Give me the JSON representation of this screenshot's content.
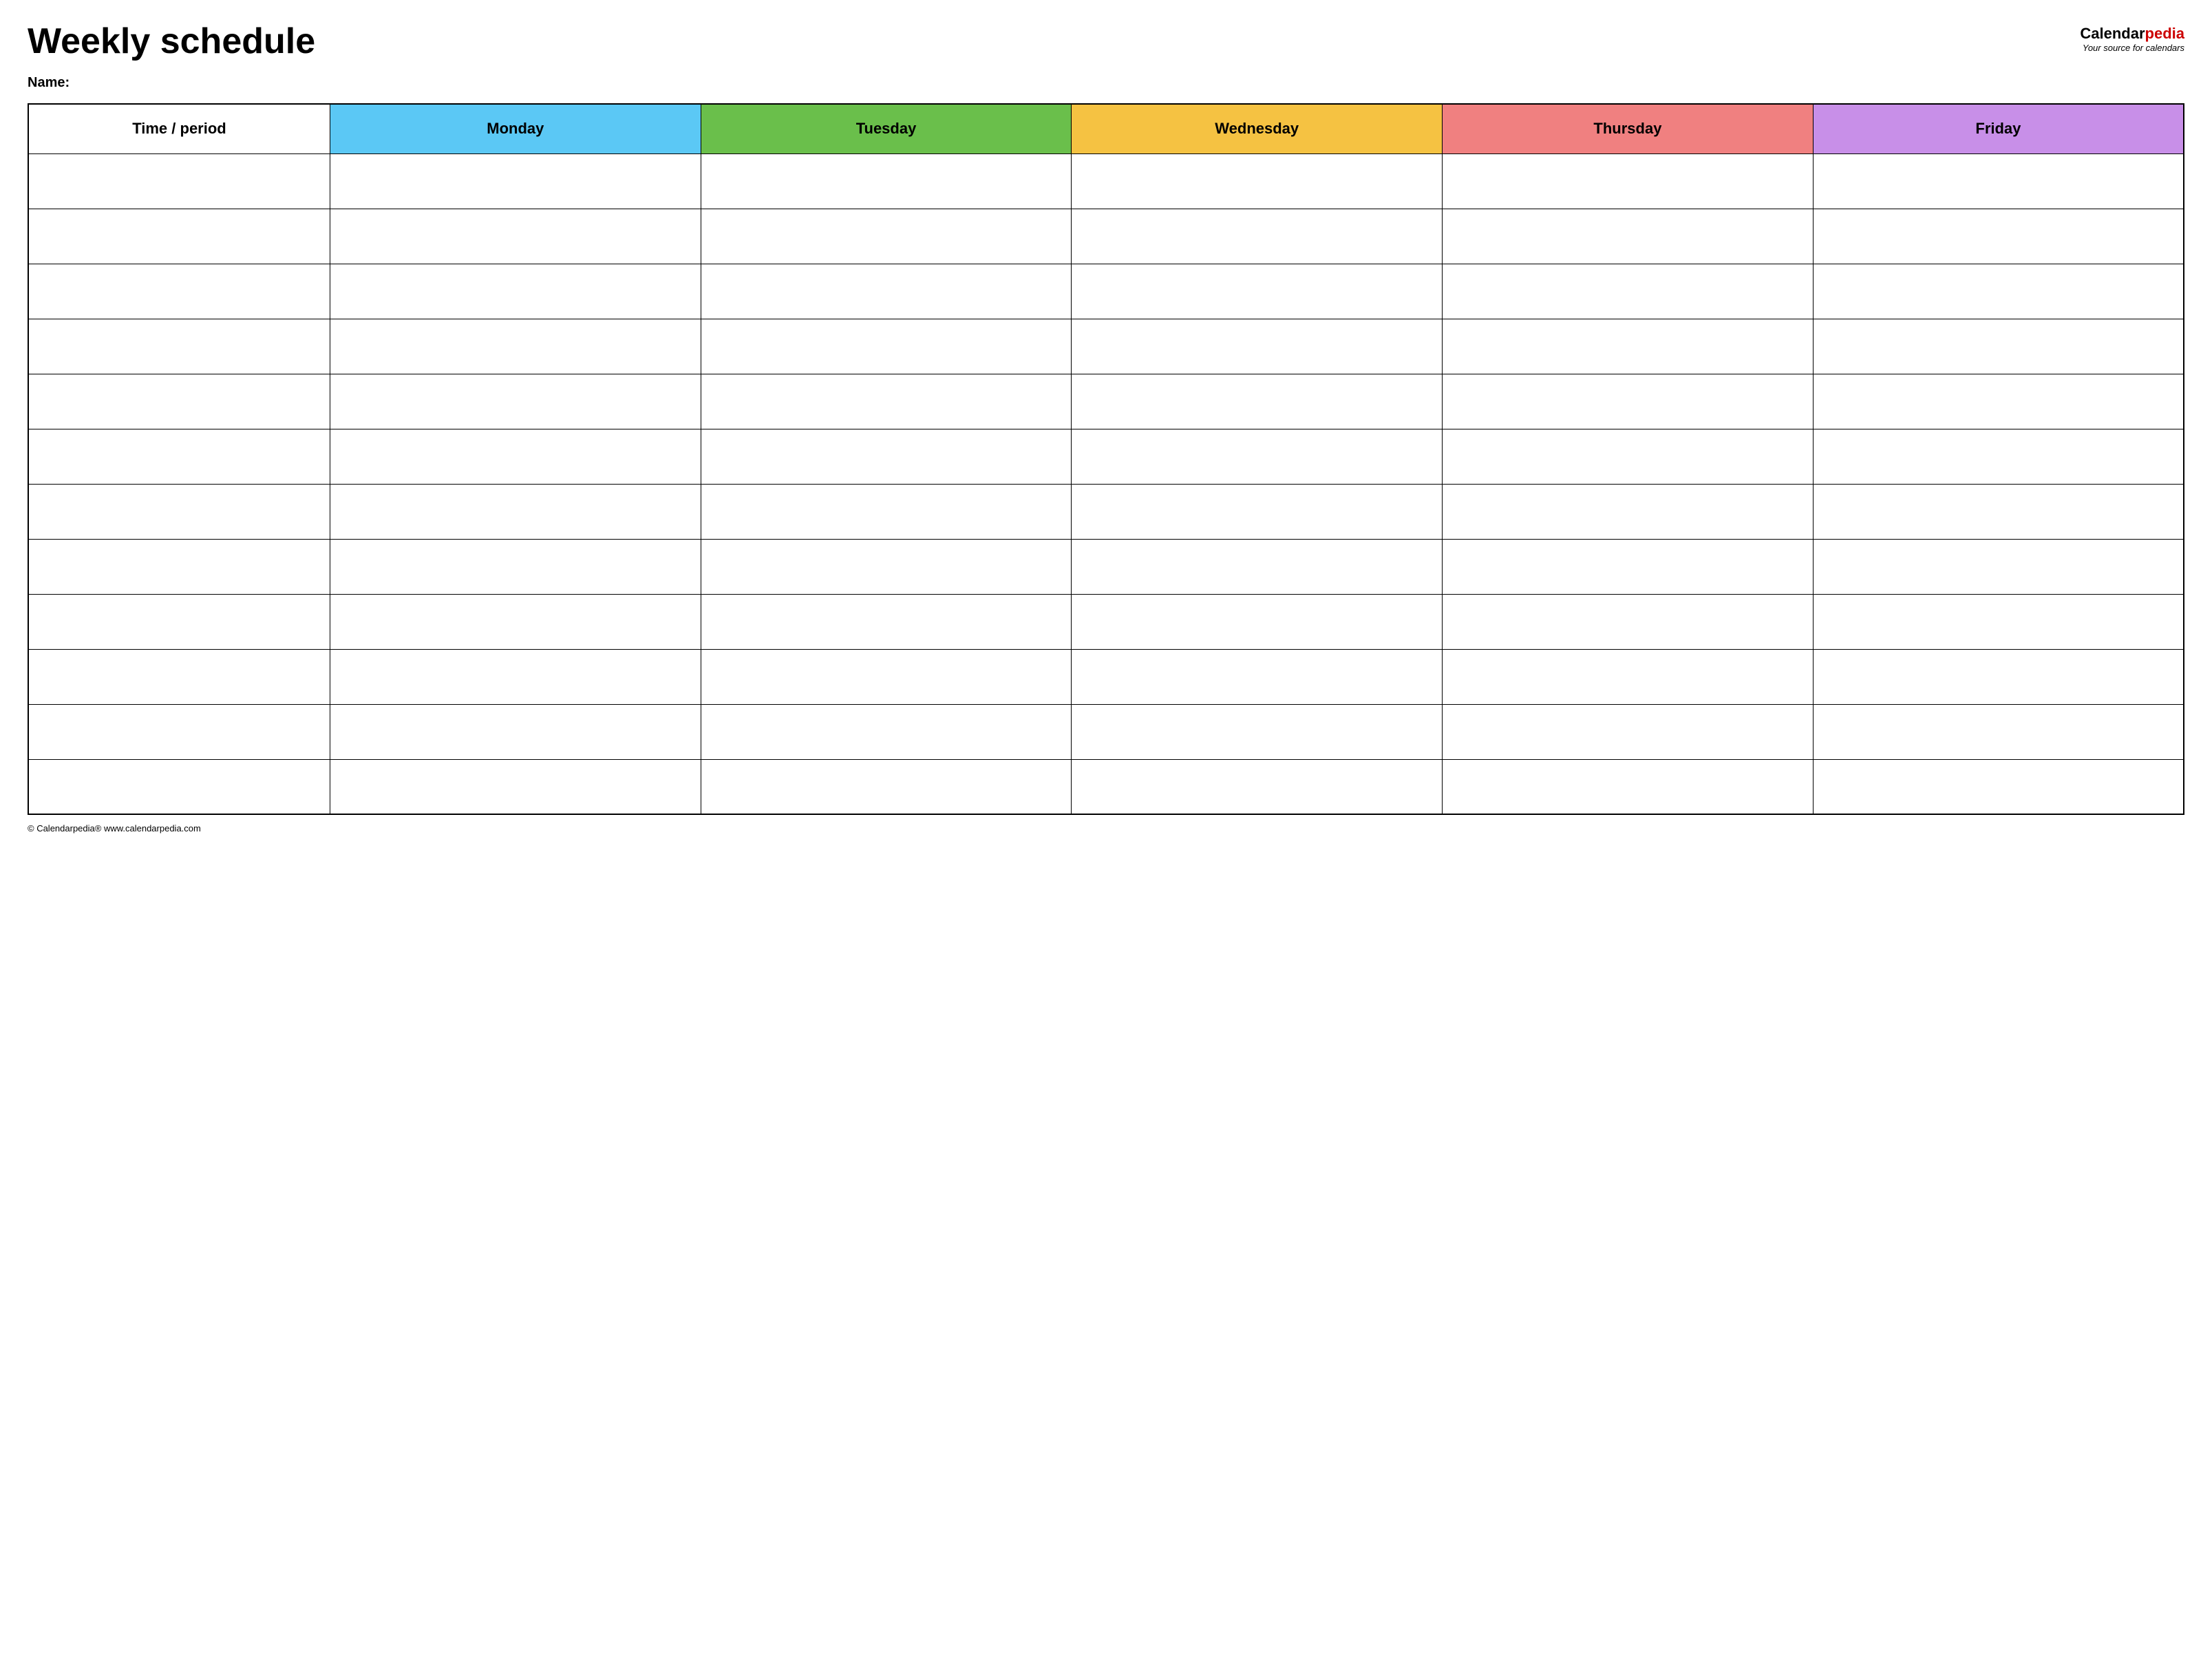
{
  "header": {
    "title": "Weekly schedule",
    "logo": {
      "brand": "Calendar",
      "pedia": "pedia",
      "subtitle": "Your source for calendars"
    }
  },
  "name_label": "Name:",
  "table": {
    "columns": [
      {
        "id": "time",
        "label": "Time / period",
        "color": "#ffffff"
      },
      {
        "id": "monday",
        "label": "Monday",
        "color": "#5bc8f5"
      },
      {
        "id": "tuesday",
        "label": "Tuesday",
        "color": "#6abf4b"
      },
      {
        "id": "wednesday",
        "label": "Wednesday",
        "color": "#f5c242"
      },
      {
        "id": "thursday",
        "label": "Thursday",
        "color": "#f08080"
      },
      {
        "id": "friday",
        "label": "Friday",
        "color": "#c88fe8"
      }
    ],
    "row_count": 12
  },
  "footer": {
    "text": "© Calendarpedia®  www.calendarpedia.com"
  }
}
